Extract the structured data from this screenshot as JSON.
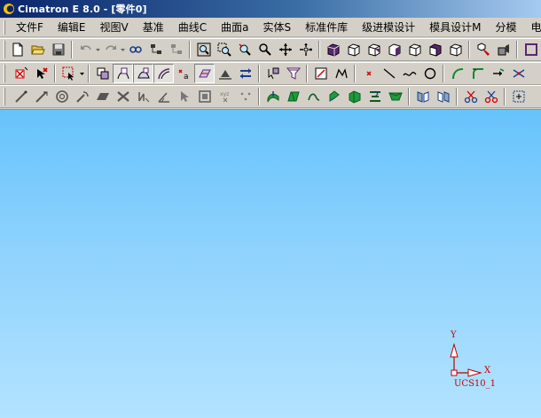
{
  "window": {
    "title": "Cimatron E 8.0 - [零件0]"
  },
  "menu": {
    "items": [
      {
        "id": "file",
        "label": "文件F"
      },
      {
        "id": "edit",
        "label": "编辑E"
      },
      {
        "id": "view",
        "label": "视图V"
      },
      {
        "id": "datum",
        "label": "基准"
      },
      {
        "id": "curve",
        "label": "曲线C"
      },
      {
        "id": "surface",
        "label": "曲面a"
      },
      {
        "id": "solid",
        "label": "实体S"
      },
      {
        "id": "standard-parts",
        "label": "标准件库"
      },
      {
        "id": "progressive-die",
        "label": "级进模设计"
      },
      {
        "id": "mold-design",
        "label": "模具设计M"
      },
      {
        "id": "parting",
        "label": "分模"
      },
      {
        "id": "electrode",
        "label": "电极"
      }
    ]
  },
  "toolbar1": {
    "buttons": [
      "new-file",
      "open-file",
      "save",
      "undo",
      "redo",
      "link",
      "tree-show",
      "tree-hide",
      "zoom-all",
      "zoom-window",
      "zoom-dynamic",
      "zoom",
      "pan",
      "rotate",
      "shaded-cube",
      "wire-cube",
      "hidden-cube",
      "plain-cube",
      "edge-cube",
      "dark-cube",
      "mixed-cube",
      "render-options",
      "lights"
    ]
  },
  "toolbar2": {
    "buttons": [
      "delete-entity",
      "delete-marked",
      "select-box",
      "show-entity",
      "pick-curves",
      "pick-faces",
      "pick-silhouette",
      "pick-points",
      "pick-surface",
      "fill-surface",
      "transform-arrows",
      "move-object",
      "filter",
      "sketch",
      "polyline",
      "point",
      "line",
      "spline",
      "circle",
      "arc-green",
      "fillet-curve",
      "trim-curve",
      "split-curve"
    ]
  },
  "toolbar3": {
    "buttons": [
      "measure-line",
      "measure-dist",
      "measure-circle",
      "measure-arc",
      "plane-cut",
      "cross-delete",
      "reflection",
      "angle",
      "pointer",
      "section-box",
      "xyz-label",
      "grid-points",
      "extrude",
      "draft",
      "ruled",
      "blend",
      "sweep",
      "split-face",
      "offset",
      "mirror-face",
      "split-body",
      "cut",
      "grid-view"
    ]
  },
  "ucs": {
    "name": "UCS10_1",
    "x_label": "X",
    "y_label": "Y"
  }
}
